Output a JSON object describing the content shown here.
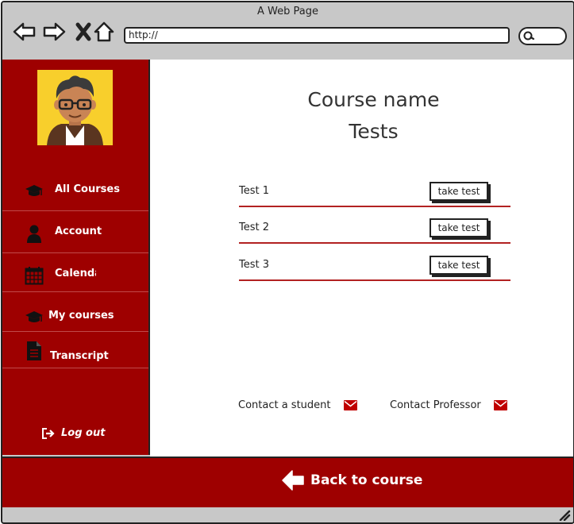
{
  "window": {
    "title": "A Web Page"
  },
  "browser": {
    "url": "http://"
  },
  "sidebar": {
    "items": [
      {
        "label": "All Courses",
        "icon": "graduation-cap-icon"
      },
      {
        "label": "Account",
        "icon": "user-icon"
      },
      {
        "label": "Calendar",
        "icon": "calendar-icon"
      },
      {
        "label": "My courses",
        "icon": "graduation-cap-icon"
      },
      {
        "label": "Transcript",
        "icon": "document-icon"
      }
    ],
    "logout_label": "Log out"
  },
  "main": {
    "title": "Course name",
    "subtitle": "Tests",
    "tests": [
      {
        "name": "Test 1",
        "action": "take test"
      },
      {
        "name": "Test 2",
        "action": "take test"
      },
      {
        "name": "Test 3",
        "action": "take test"
      }
    ],
    "contact_student": "Contact a student",
    "contact_professor": "Contact Professor"
  },
  "footer": {
    "back_label": "Back to course"
  },
  "colors": {
    "accent": "#9e0000",
    "underline": "#b22222"
  }
}
